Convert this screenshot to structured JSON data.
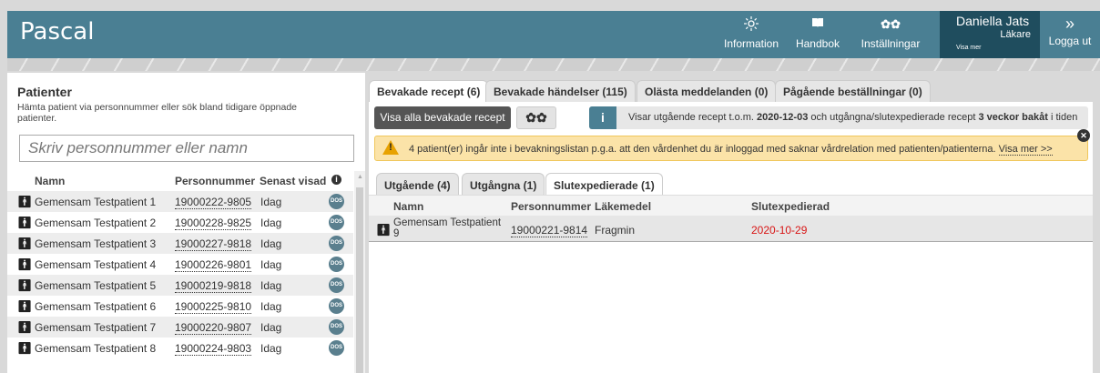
{
  "app": {
    "title": "Pascal",
    "header_color": "#4a7f93"
  },
  "nav": [
    {
      "icon": "sun-icon",
      "label": "Information"
    },
    {
      "icon": "book-icon",
      "label": "Handbok"
    },
    {
      "icon": "gears-icon",
      "label": "Inställningar"
    }
  ],
  "user": {
    "name": "Daniella Jats",
    "role": "Läkare",
    "more": "Visa mer"
  },
  "logout": {
    "label": "Logga ut"
  },
  "patients": {
    "title": "Patienter",
    "subtitle": "Hämta patient via personnummer eller sök bland tidigare öppnade patienter.",
    "search_placeholder": "Skriv personnummer eller namn",
    "columns": {
      "name": "Namn",
      "pnr": "Personnummer",
      "seen": "Senast visad"
    },
    "badge": "DOS",
    "rows": [
      {
        "name": "Gemensam Testpatient 1",
        "pnr": "19000222-9805",
        "seen": "Idag"
      },
      {
        "name": "Gemensam Testpatient 2",
        "pnr": "19000228-9825",
        "seen": "Idag"
      },
      {
        "name": "Gemensam Testpatient 3",
        "pnr": "19000227-9818",
        "seen": "Idag"
      },
      {
        "name": "Gemensam Testpatient 4",
        "pnr": "19000226-9801",
        "seen": "Idag"
      },
      {
        "name": "Gemensam Testpatient 5",
        "pnr": "19000219-9818",
        "seen": "Idag"
      },
      {
        "name": "Gemensam Testpatient 6",
        "pnr": "19000225-9810",
        "seen": "Idag"
      },
      {
        "name": "Gemensam Testpatient 7",
        "pnr": "19000220-9807",
        "seen": "Idag"
      },
      {
        "name": "Gemensam Testpatient 8",
        "pnr": "19000224-9803",
        "seen": "Idag"
      }
    ]
  },
  "tabs": [
    {
      "label": "Bevakade recept (6)",
      "active": true
    },
    {
      "label": "Bevakade händelser (115)",
      "active": false
    },
    {
      "label": "Olästa meddelanden (0)",
      "active": false
    },
    {
      "label": "Pågående beställningar (0)",
      "active": false
    }
  ],
  "toolbar": {
    "show_all": "Visa alla bevakade recept"
  },
  "info": {
    "text1": "Visar utgående recept t.o.m. ",
    "date": "2020-12-03",
    "text2": " och utgångna/slutexpedierade recept ",
    "weeks": "3 veckor bakåt",
    "text3": " i tiden"
  },
  "warning": {
    "text": "4 patient(er) ingår inte i bevakningslistan p.g.a. att den vårdenhet du är inloggad med saknar vårdrelation med patienten/patienterna. ",
    "link": "Visa mer >>"
  },
  "subtabs": [
    {
      "label": "Utgående (4)",
      "active": false
    },
    {
      "label": "Utgångna (1)",
      "active": false
    },
    {
      "label": "Slutexpedierade (1)",
      "active": true
    }
  ],
  "recipes": {
    "columns": {
      "name": "Namn",
      "pnr": "Personnummer",
      "drug": "Läkemedel",
      "date": "Slutexpedierad"
    },
    "rows": [
      {
        "name": "Gemensam Testpatient 9",
        "pnr": "19000221-9814",
        "drug": "Fragmin",
        "date": "2020-10-29",
        "date_color": "#d81515"
      }
    ]
  }
}
